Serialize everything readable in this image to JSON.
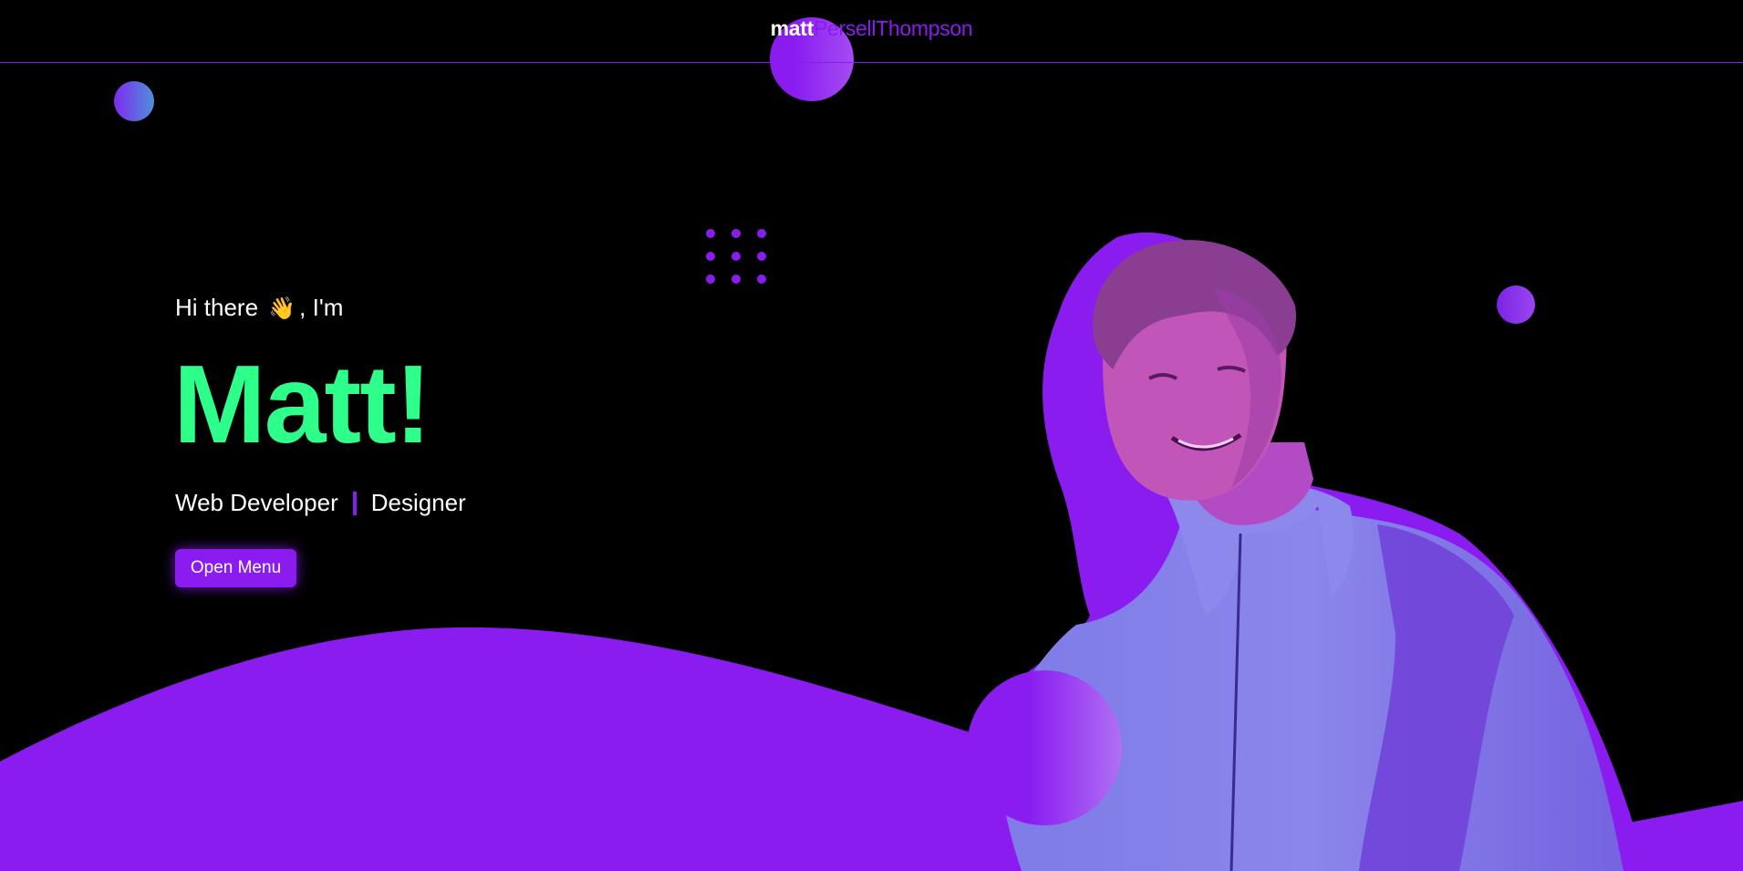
{
  "header": {
    "logo_first": "matt",
    "logo_rest": "PersellThompson"
  },
  "hero": {
    "greeting_prefix": "Hi there",
    "greeting_emoji": "👋",
    "greeting_suffix": ", I'm",
    "name": "Matt!",
    "role_1": "Web Developer",
    "role_2": "Designer",
    "button_label": "Open Menu"
  },
  "colors": {
    "background": "#000000",
    "accent": "#8a1cf0",
    "name_green": "#2eff8a",
    "text": "#ffffff"
  },
  "icons": {
    "wave": "waving-hand-emoji",
    "dots": "dot-grid-decoration"
  }
}
